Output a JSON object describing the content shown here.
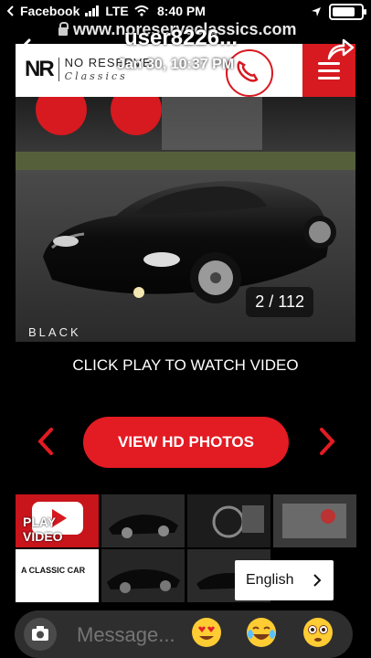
{
  "status_bar": {
    "carrier": "Facebook",
    "signal_text": "LTE",
    "time": "8:40 PM"
  },
  "browser": {
    "url": "www.noreserveclassics.com"
  },
  "story_overlay": {
    "username": "user8226...",
    "date": "Jan 30, 10:37 PM"
  },
  "site": {
    "logo_mark": "NR",
    "logo_text": "NO RESERVE",
    "logo_script": "Classics",
    "colors": {
      "accent": "#d71920",
      "header_bg": "#ffffff"
    }
  },
  "hero": {
    "counter": "2 / 112",
    "brand_caption": "BLACK"
  },
  "video_prompt": "CLICK PLAY TO WATCH VIDEO",
  "gallery_nav": {
    "hd_button": "VIEW HD PHOTOS",
    "prev_icon": "chevron-left-icon",
    "next_icon": "chevron-right-icon"
  },
  "thumbnails": {
    "play_video_label": "PLAY VIDEO",
    "classic_car_label": "A CLASSIC CAR"
  },
  "language": {
    "selected": "English"
  },
  "message_bar": {
    "placeholder": "Message...",
    "quick_reactions": [
      "heart-eyes-emoji",
      "laughing-emoji",
      "flushed-emoji"
    ]
  }
}
